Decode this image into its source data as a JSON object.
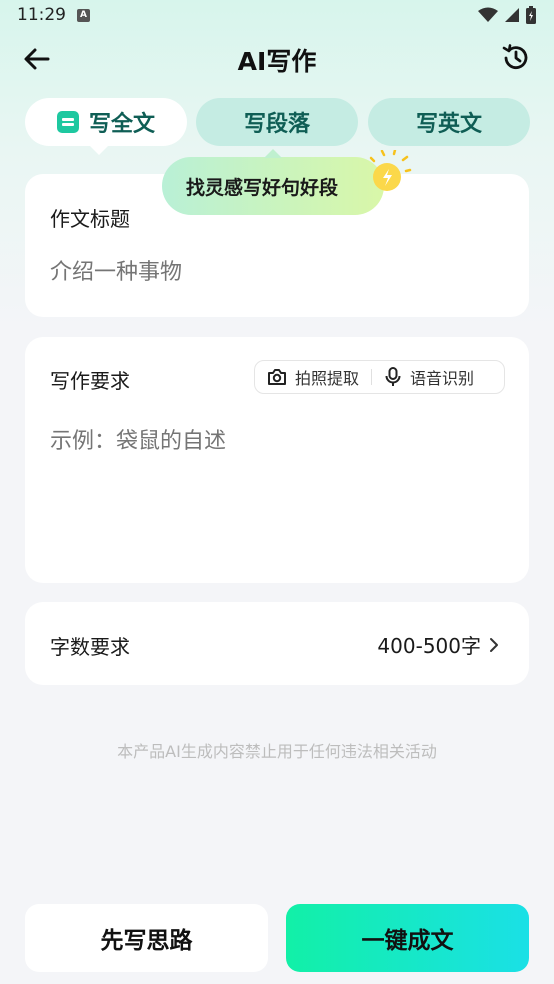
{
  "status_bar": {
    "time": "11:29",
    "notif_letter": "A"
  },
  "header": {
    "title": "AI写作"
  },
  "tabs": [
    {
      "label": "写全文",
      "active": true
    },
    {
      "label": "写段落",
      "active": false
    },
    {
      "label": "写英文",
      "active": false
    }
  ],
  "tooltip": {
    "text": "找灵感写好句好段"
  },
  "title_card": {
    "label": "作文标题",
    "placeholder": "介绍一种事物"
  },
  "requirement_card": {
    "label": "写作要求",
    "photo_label": "拍照提取",
    "voice_label": "语音识别",
    "placeholder": "示例：袋鼠的自述"
  },
  "count_card": {
    "label": "字数要求",
    "value": "400-500字"
  },
  "disclaimer": "本产品AI生成内容禁止用于任何违法相关活动",
  "actions": {
    "outline_label": "先写思路",
    "generate_label": "一键成文"
  },
  "colors": {
    "accent": "#1ec8a0",
    "tab_bg": "#c5ece3",
    "tab_text": "#0f5e55"
  }
}
